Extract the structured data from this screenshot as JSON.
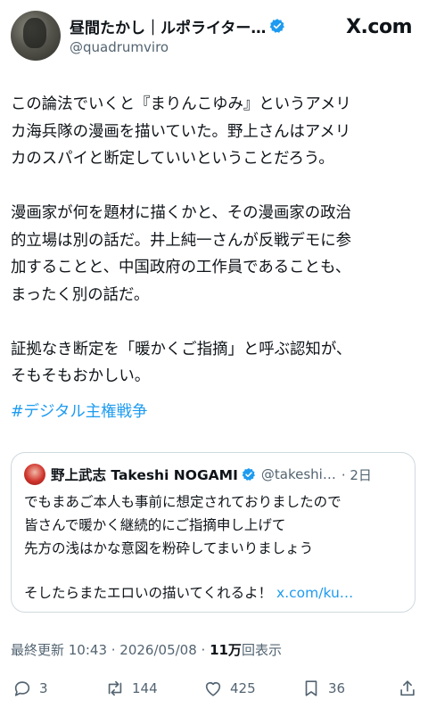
{
  "header": {
    "display_name": "昼間たかし｜ルポライター…",
    "handle": "@quadrumviro",
    "watermark": "X.com"
  },
  "post": {
    "text": "この論法でいくと『まりんこゆみ』というアメリ\nカ海兵隊の漫画を描いていた。野上さんはアメリ\nカのスパイと断定していいということだろう。\n\n漫画家が何を題材に描くかと、その漫画家の政治\n的立場は別の話だ。井上純一さんが反戦デモに参\n加することと、中国政府の工作員であることも、\nまったく別の話だ。\n\n証拠なき断定を「暖かくご指摘」と呼ぶ認知が、\nそもそもおかしい。",
    "hashtag": "#デジタル主権戦争"
  },
  "quote": {
    "name": "野上武志 Takeshi NOGAMI",
    "handle": "@takeshi…",
    "time": "· 2日",
    "text": "でもまあご本人も事前に想定されておりましたので\n皆さんで暖かく継続的にご指摘申し上げて\n先方の浅はかな意図を粉砕してまいりましょう",
    "last_line": "そしたらまたエロいの描いてくれるよ！",
    "link": "x.com/ku…"
  },
  "meta": {
    "updated": "最終更新 10:43 · 2026/05/08 · ",
    "views_count": "11万",
    "views_label": "回表示"
  },
  "actions": {
    "replies": "3",
    "reposts": "144",
    "likes": "425",
    "bookmarks": "36"
  },
  "colors": {
    "accent": "#1d9bf0",
    "text": "#0f1419",
    "muted": "#536471",
    "border": "#cfd9de"
  }
}
